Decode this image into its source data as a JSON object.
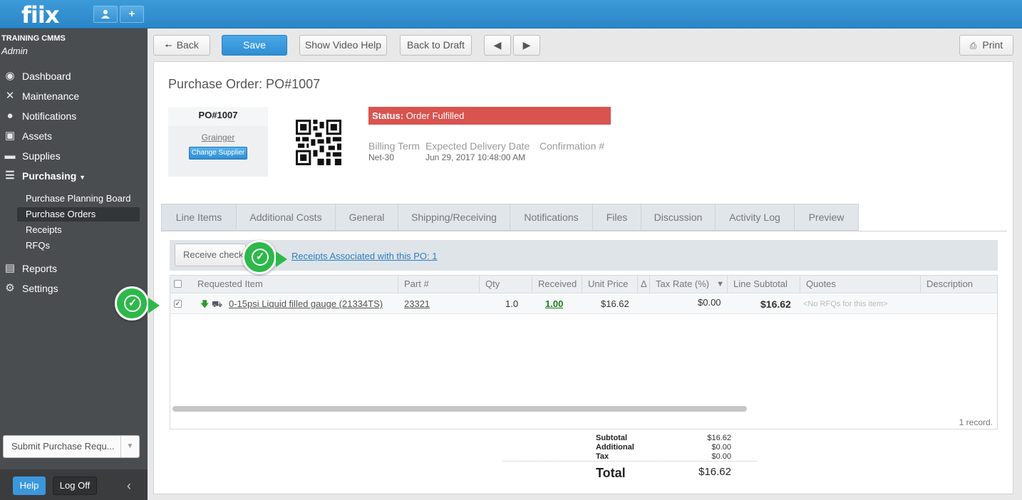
{
  "app": {
    "logo": "fiix"
  },
  "sidebar": {
    "org": "TRAINING CMMS",
    "role": "Admin",
    "items": [
      {
        "label": "Dashboard",
        "icon": "dashboard-icon"
      },
      {
        "label": "Maintenance",
        "icon": "wrench-icon"
      },
      {
        "label": "Notifications",
        "icon": "speech-bubble-icon"
      },
      {
        "label": "Assets",
        "icon": "boxes-icon"
      },
      {
        "label": "Supplies",
        "icon": "truck-icon"
      },
      {
        "label": "Purchasing",
        "icon": "cart-icon"
      }
    ],
    "purchasing_sub": [
      {
        "label": "Purchase Planning Board"
      },
      {
        "label": "Purchase Orders"
      },
      {
        "label": "Receipts"
      },
      {
        "label": "RFQs"
      }
    ],
    "items2": [
      {
        "label": "Reports",
        "icon": "chart-icon"
      },
      {
        "label": "Settings",
        "icon": "gear-icon"
      }
    ],
    "submit_request": "Submit Purchase Requ...",
    "help": "Help",
    "logoff": "Log Off"
  },
  "toolbar": {
    "back": "Back",
    "save": "Save",
    "video_help": "Show Video Help",
    "back_to_draft": "Back to Draft",
    "print": "Print"
  },
  "po": {
    "title": "Purchase Order: PO#1007",
    "number": "PO#1007",
    "supplier": "Grainger",
    "change_supplier": "Change Supplier",
    "status_label": "Status:",
    "status_value": "Order Fulfilled",
    "billing_term_label": "Billing Term",
    "billing_term": "Net-30",
    "delivery_label": "Expected Delivery Date",
    "delivery": "Jun 29, 2017 10:48:00 AM",
    "confirmation_label": "Confirmation #"
  },
  "tabs": [
    "Line Items",
    "Additional Costs",
    "General",
    "Shipping/Receiving",
    "Notifications",
    "Files",
    "Discussion",
    "Activity Log",
    "Preview"
  ],
  "line_items": {
    "receive_button": "Receive checked",
    "receipts_link": "Receipts Associated with this PO: 1",
    "columns": [
      "Requested Item",
      "Part #",
      "Qty",
      "Received",
      "Unit Price",
      "Δ",
      "Tax Rate (%)",
      "Line Subtotal",
      "Quotes",
      "Description"
    ],
    "rows": [
      {
        "item": "0-15psi Liquid filled gauge (21334TS)",
        "part": "23321",
        "qty": "1.0",
        "received": "1.00",
        "unit_price": "$16.62",
        "tax": "$0.00",
        "subtotal": "$16.62",
        "quotes": "<No RFQs for this item>"
      }
    ],
    "records": "1 record."
  },
  "totals": {
    "subtotal_label": "Subtotal",
    "subtotal": "$16.62",
    "additional_label": "Additional",
    "additional": "$0.00",
    "tax_label": "Tax",
    "tax": "$0.00",
    "total_label": "Total",
    "total": "$16.62"
  },
  "colors": {
    "brand": "#2a86c8",
    "status": "#d9534f",
    "marker": "#2db84a",
    "received": "#1a7f1a"
  }
}
